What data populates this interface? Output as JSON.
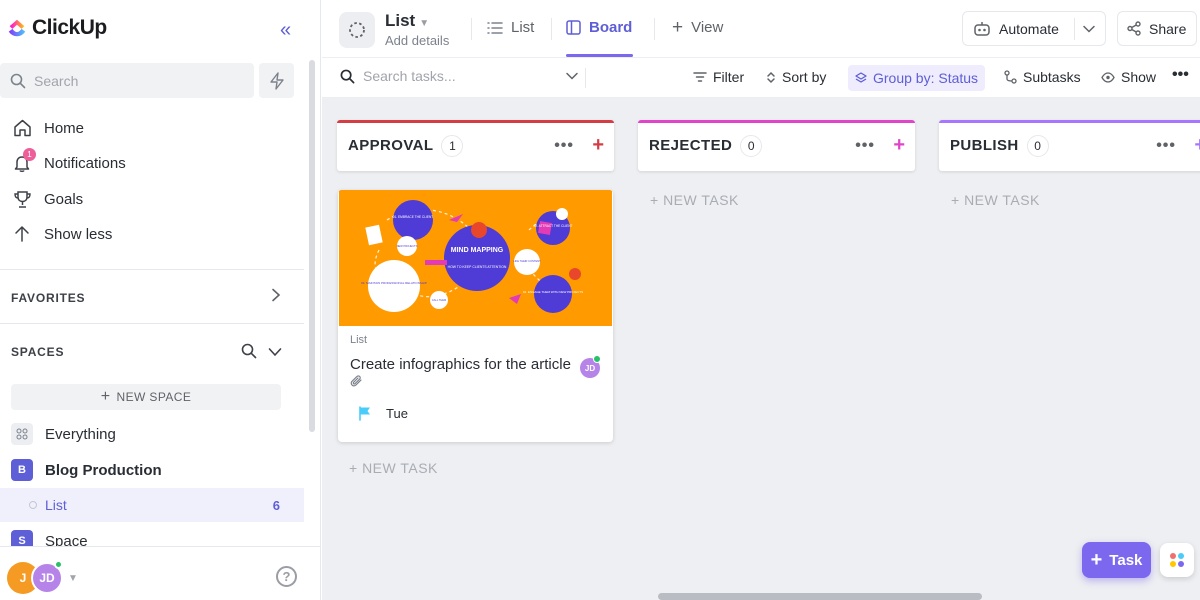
{
  "app": {
    "name": "ClickUp"
  },
  "colors": {
    "accent": "#7b68ee",
    "approval": "#d33d44",
    "rejected": "#e044c9",
    "publish": "#a875ff",
    "card_image_bg": "#ff9a00"
  },
  "sidebar": {
    "search_placeholder": "Search",
    "nav": [
      {
        "label": "Home",
        "icon": "home-icon"
      },
      {
        "label": "Notifications",
        "icon": "bell-icon",
        "badge": "1"
      },
      {
        "label": "Goals",
        "icon": "trophy-icon"
      },
      {
        "label": "Show less",
        "icon": "arrow-up-icon"
      }
    ],
    "favorites_label": "FAVORITES",
    "spaces_label": "SPACES",
    "new_space_label": "NEW SPACE",
    "spaces": [
      {
        "label": "Everything",
        "icon": "grid-icon"
      },
      {
        "label": "Blog Production",
        "badge": "B",
        "color": "#5e5ed6"
      },
      {
        "label": "List",
        "count": "6"
      },
      {
        "label": "Space",
        "badge": "S",
        "color": "#5e5ed6"
      }
    ],
    "footer": {
      "avatar_1": "J",
      "avatar_2": "JD",
      "help": "?"
    }
  },
  "header": {
    "title": "List",
    "subtitle": "Add details",
    "tabs": [
      {
        "label": "List",
        "icon": "list-icon"
      },
      {
        "label": "Board",
        "icon": "board-icon",
        "active": true
      },
      {
        "label": "View",
        "icon": "plus-icon"
      }
    ],
    "automate_label": "Automate",
    "share_label": "Share"
  },
  "toolbar": {
    "search_placeholder": "Search tasks...",
    "filter_label": "Filter",
    "sort_label": "Sort by",
    "group_label": "Group by: Status",
    "subtasks_label": "Subtasks",
    "show_label": "Show"
  },
  "board": {
    "new_task_label": "+ NEW TASK",
    "columns": [
      {
        "name": "APPROVAL",
        "count": "1"
      },
      {
        "name": "REJECTED",
        "count": "0"
      },
      {
        "name": "PUBLISH",
        "count": "0"
      }
    ],
    "card": {
      "list": "List",
      "title": "Create infographics for the article",
      "assignee": "JD",
      "due": "Tue",
      "image": {
        "center_title": "MIND MAPPING",
        "center_sub": "HOW TO KEEP CLIENTS ATTENTION",
        "nodes": [
          "01. EMBRACE THE CLIENT",
          "02. ATTRACT THE CLIENT",
          "03. MAINTAIN PROFESSIONAL RELATIONSHIP",
          "04. ENGAGE THEM WITH NEW PROJECTS",
          "NEW PROJECTS",
          "LIKE THEIR CONTENT",
          "CALL THEM"
        ]
      }
    }
  },
  "fab": {
    "task_label": "Task"
  }
}
